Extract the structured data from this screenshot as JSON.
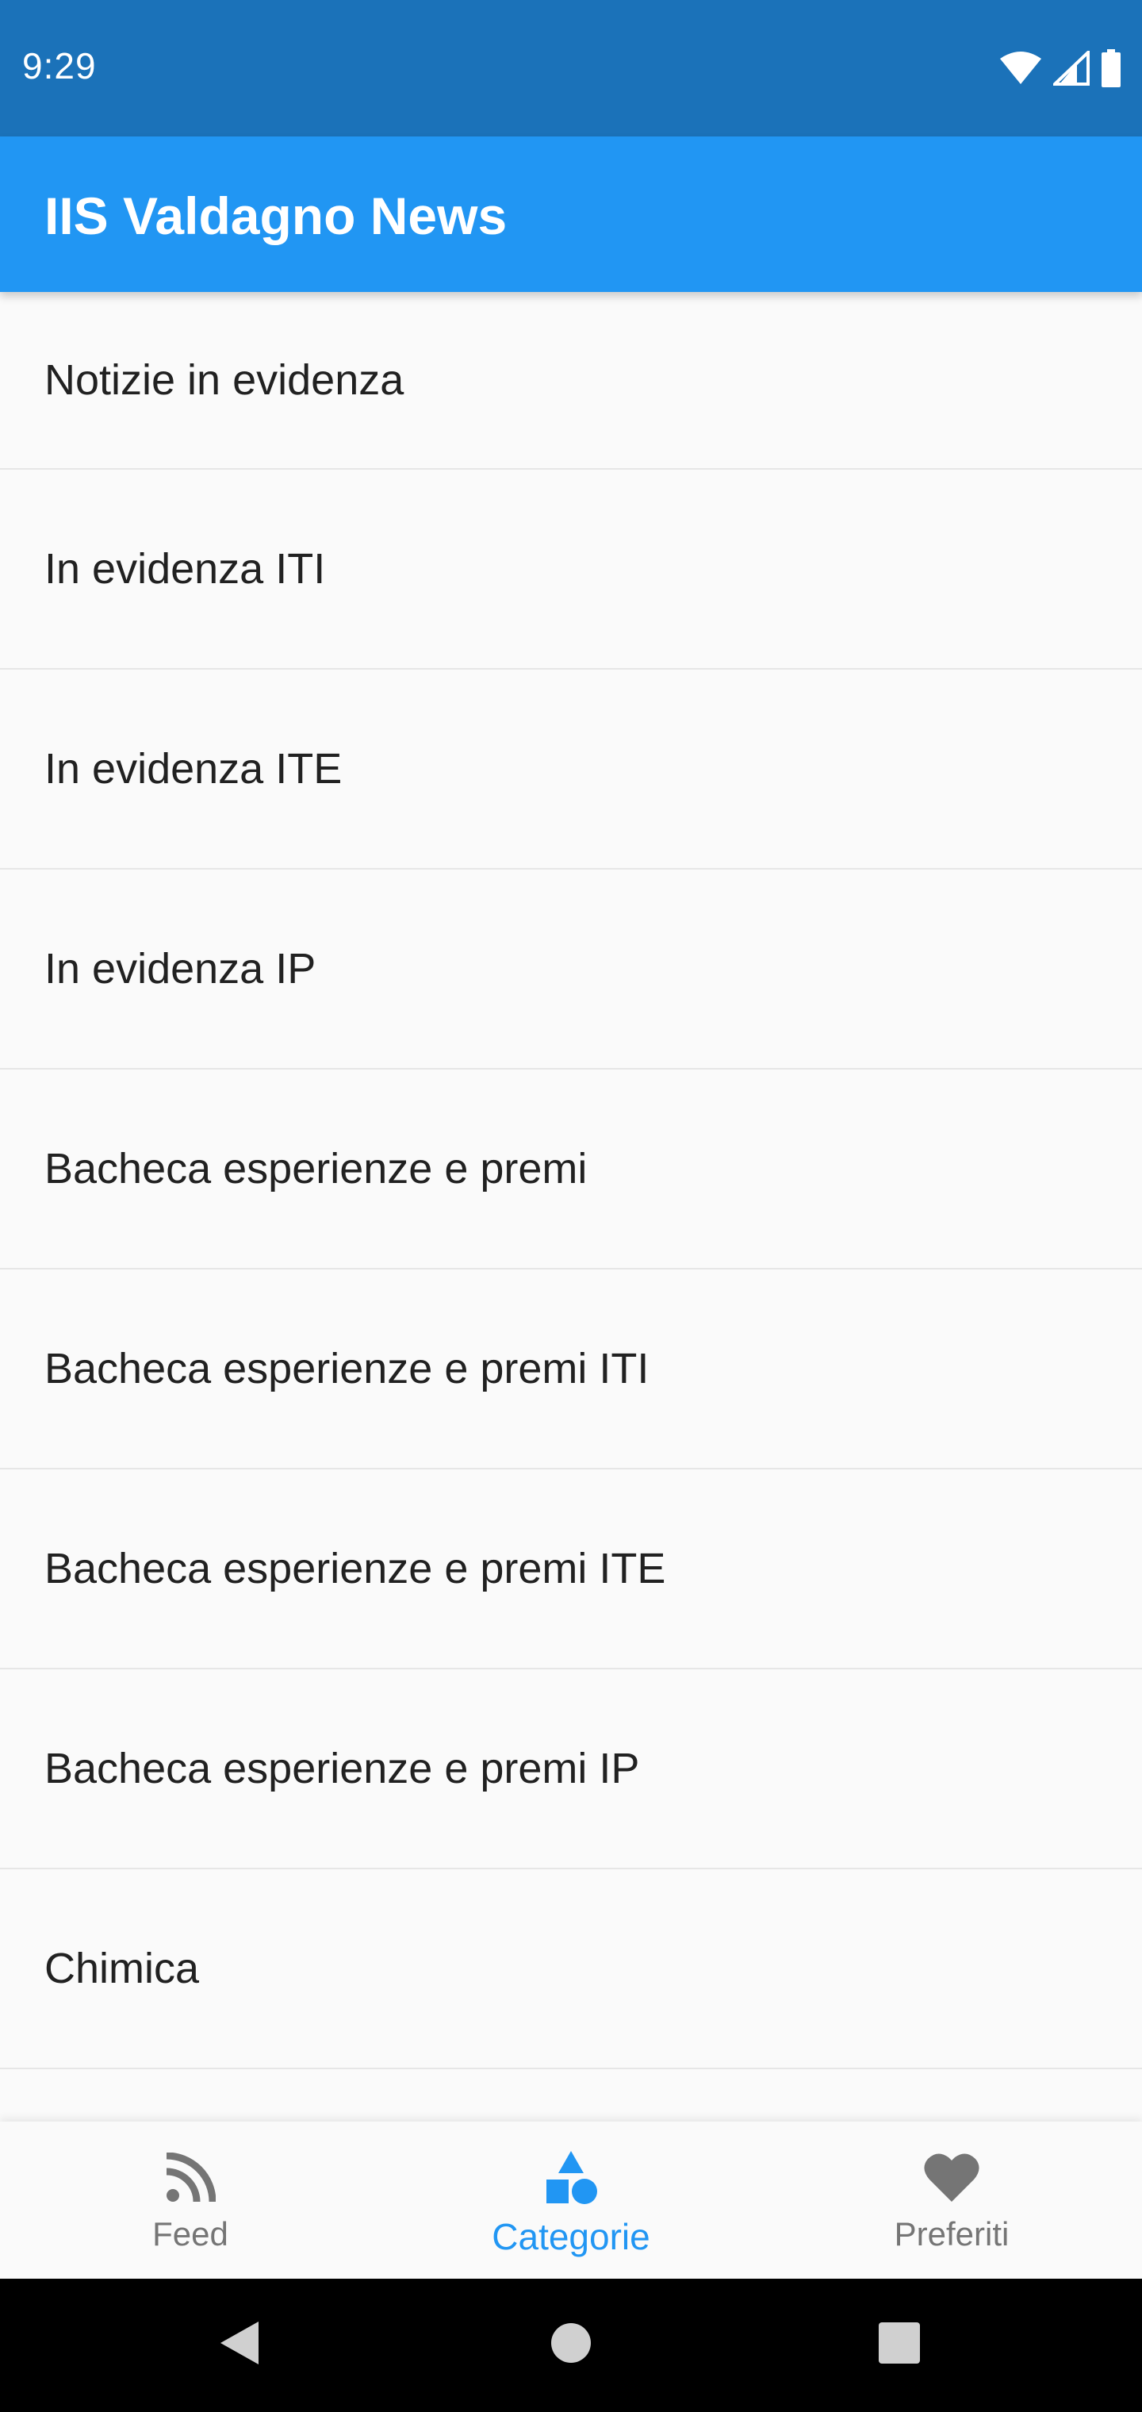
{
  "status_bar": {
    "time": "9:29",
    "icons": [
      "wifi-icon",
      "cellular-signal-icon",
      "battery-icon"
    ]
  },
  "app_bar": {
    "title": "IIS Valdagno News",
    "color": "#2196f3"
  },
  "categories": [
    {
      "label": "Notizie in evidenza"
    },
    {
      "label": "In evidenza ITI"
    },
    {
      "label": "In evidenza ITE"
    },
    {
      "label": "In evidenza IP"
    },
    {
      "label": "Bacheca esperienze e premi"
    },
    {
      "label": "Bacheca esperienze e premi ITI"
    },
    {
      "label": "Bacheca esperienze e premi ITE"
    },
    {
      "label": "Bacheca esperienze e premi IP"
    },
    {
      "label": "Chimica"
    }
  ],
  "bottom_nav": {
    "items": [
      {
        "label": "Feed",
        "icon": "rss-feed-icon",
        "active": false
      },
      {
        "label": "Categorie",
        "icon": "category-shapes-icon",
        "active": true
      },
      {
        "label": "Preferiti",
        "icon": "heart-icon",
        "active": false
      }
    ],
    "active_color": "#2196f3",
    "inactive_color": "#757575"
  },
  "system_nav": {
    "buttons": [
      "back-icon",
      "home-icon",
      "recents-icon"
    ]
  }
}
